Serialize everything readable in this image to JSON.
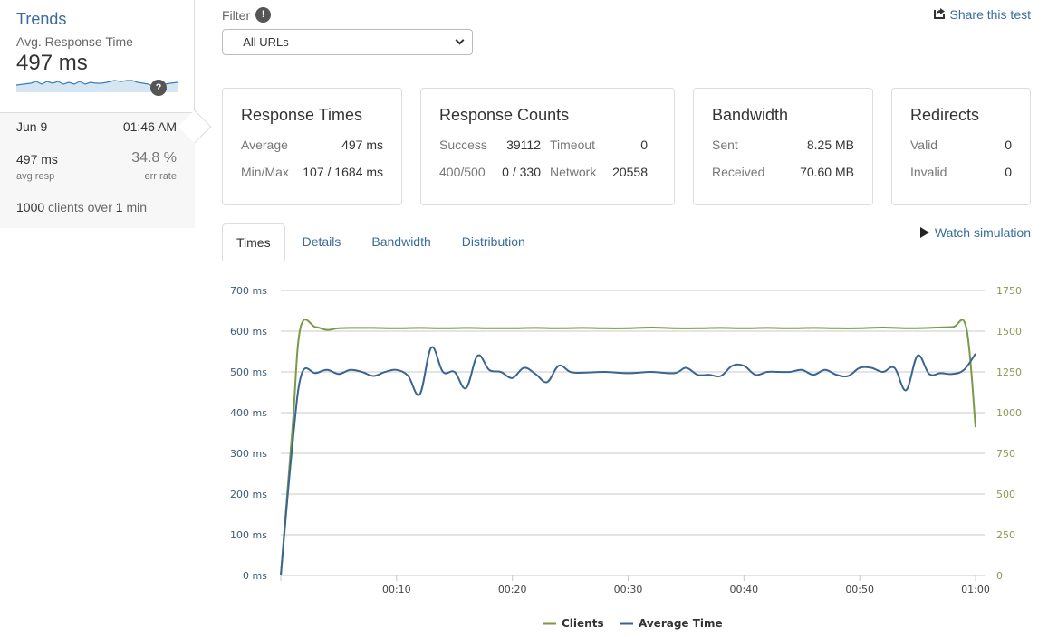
{
  "sidebar": {
    "trends_title": "Trends",
    "trends_subtitle": "Avg. Response Time",
    "trends_value": "497 ms",
    "help_icon": "?",
    "summary": {
      "date": "Jun 9",
      "time": "01:46 AM",
      "avg_resp_value": "497 ms",
      "avg_resp_label": "avg resp",
      "err_rate_value": "34.8 %",
      "err_rate_label": "err rate",
      "clients_count": "1000",
      "clients_text": "clients over",
      "duration_count": "1",
      "duration_unit": "min"
    }
  },
  "filter": {
    "label": "Filter",
    "info_icon": "!",
    "selected": "- All URLs -"
  },
  "share_link": "Share this test",
  "cards": {
    "response_times": {
      "title": "Response Times",
      "average_label": "Average",
      "average_value": "497 ms",
      "minmax_label": "Min/Max",
      "minmax_value": "107 / 1684 ms"
    },
    "response_counts": {
      "title": "Response Counts",
      "success_label": "Success",
      "success_value": "39112",
      "timeout_label": "Timeout",
      "timeout_value": "0",
      "errors_label": "400/500",
      "errors_value": "0 / 330",
      "network_label": "Network",
      "network_value": "20558"
    },
    "bandwidth": {
      "title": "Bandwidth",
      "sent_label": "Sent",
      "sent_value": "8.25 MB",
      "received_label": "Received",
      "received_value": "70.60 MB"
    },
    "redirects": {
      "title": "Redirects",
      "valid_label": "Valid",
      "valid_value": "0",
      "invalid_label": "Invalid",
      "invalid_value": "0"
    }
  },
  "tabs": [
    {
      "label": "Times",
      "active": true
    },
    {
      "label": "Details",
      "active": false
    },
    {
      "label": "Bandwidth",
      "active": false
    },
    {
      "label": "Distribution",
      "active": false
    }
  ],
  "watch_simulation": "Watch simulation",
  "colors": {
    "link": "#3a6c9a",
    "clients": "#7a9a4a",
    "average_time": "#3a6591"
  },
  "chart_data": {
    "type": "line",
    "title": "",
    "x_ticks": [
      "00:10",
      "00:20",
      "00:30",
      "00:40",
      "00:50",
      "01:00"
    ],
    "x_range_seconds": [
      0,
      60
    ],
    "y_left": {
      "label": "Average Time",
      "unit": "ms",
      "range": [
        0,
        700
      ],
      "ticks": [
        "0 ms",
        "100 ms",
        "200 ms",
        "300 ms",
        "400 ms",
        "500 ms",
        "600 ms",
        "700 ms"
      ]
    },
    "y_right": {
      "label": "Clients",
      "range": [
        0,
        1750
      ],
      "ticks": [
        "0",
        "250",
        "500",
        "750",
        "1000",
        "1250",
        "1500",
        "1750"
      ]
    },
    "grid": true,
    "legend_position": "bottom",
    "series": [
      {
        "name": "Clients",
        "axis": "right",
        "x": [
          0,
          1,
          1.7,
          3,
          4,
          5,
          6,
          8,
          10,
          12,
          14,
          16,
          18,
          20,
          22,
          24,
          26,
          28,
          30,
          32,
          34,
          36,
          38,
          40,
          42,
          44,
          46,
          48,
          50,
          52,
          54,
          56,
          58,
          59.2,
          60
        ],
        "values": [
          0,
          900,
          1520,
          1525,
          1508,
          1518,
          1520,
          1520,
          1518,
          1520,
          1518,
          1520,
          1518,
          1518,
          1520,
          1518,
          1520,
          1518,
          1518,
          1522,
          1518,
          1518,
          1520,
          1518,
          1520,
          1518,
          1520,
          1518,
          1518,
          1522,
          1518,
          1520,
          1525,
          1520,
          910
        ]
      },
      {
        "name": "Average Time",
        "axis": "left",
        "x": [
          0,
          1,
          1.8,
          3,
          4,
          5,
          6,
          7,
          8,
          9,
          10,
          11,
          12,
          13,
          14,
          15,
          16,
          17,
          18,
          19,
          20,
          21,
          22,
          23,
          24,
          25,
          26,
          28,
          30,
          32,
          34,
          35,
          36,
          37,
          38,
          39,
          40,
          41,
          42,
          43,
          44,
          45,
          46,
          47,
          48,
          49,
          50,
          51,
          52,
          53,
          54,
          55,
          56,
          57,
          58,
          59,
          60
        ],
        "values": [
          0,
          320,
          495,
          497,
          505,
          495,
          505,
          500,
          490,
          500,
          505,
          490,
          445,
          560,
          500,
          500,
          460,
          540,
          505,
          500,
          485,
          510,
          495,
          475,
          515,
          500,
          498,
          500,
          497,
          500,
          497,
          510,
          493,
          493,
          490,
          515,
          515,
          493,
          500,
          500,
          500,
          505,
          493,
          505,
          493,
          490,
          510,
          510,
          500,
          510,
          455,
          540,
          495,
          497,
          495,
          505,
          545
        ]
      }
    ]
  }
}
